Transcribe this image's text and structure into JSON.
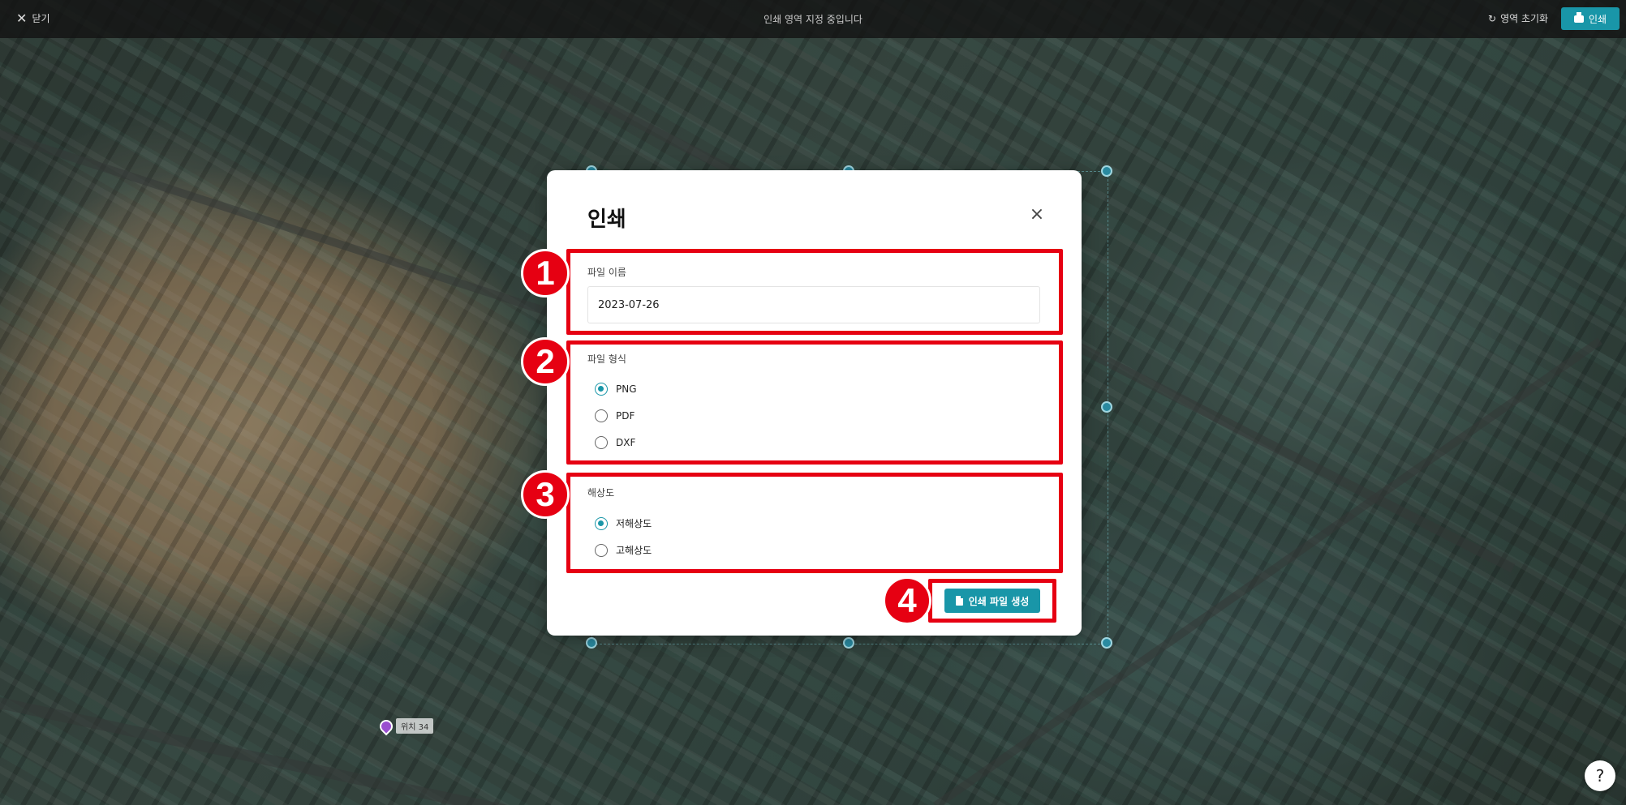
{
  "topbar": {
    "close_label": "닫기",
    "title": "인쇄 영역 지정 중입니다",
    "reset_label": "영역 초기화",
    "print_label": "인쇄"
  },
  "map": {
    "pin_label": "위치 34"
  },
  "modal": {
    "title": "인쇄",
    "filename": {
      "label": "파일 이름",
      "value": "2023-07-26"
    },
    "format": {
      "label": "파일 형식",
      "options": [
        "PNG",
        "PDF",
        "DXF"
      ],
      "selected": "PNG"
    },
    "resolution": {
      "label": "해상도",
      "options": [
        "저해상도",
        "고해상도"
      ],
      "selected": "저해상도"
    },
    "generate_label": "인쇄 파일 생성"
  },
  "annotations": {
    "steps": [
      "1",
      "2",
      "3",
      "4"
    ],
    "highlight_color": "#e60012"
  },
  "help_label": "?",
  "colors": {
    "accent": "#1996a8"
  }
}
